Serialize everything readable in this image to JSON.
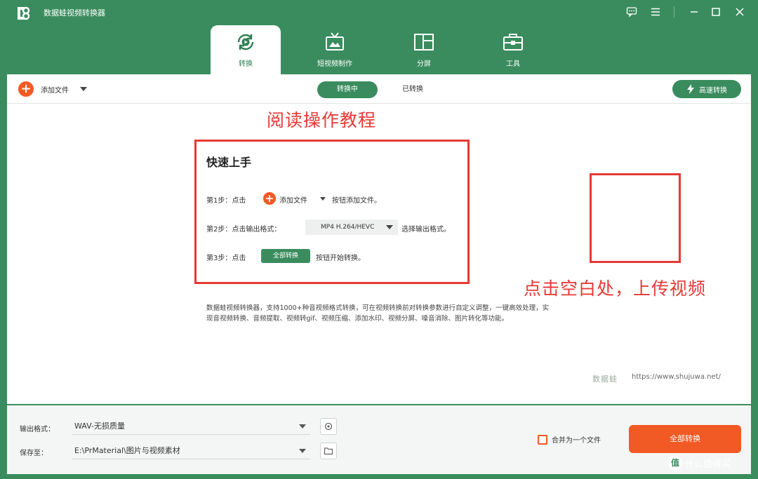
{
  "app": {
    "title": "数据蛙视频转换器"
  },
  "tabs": [
    {
      "label": "转换",
      "icon": "convert-icon",
      "active": true
    },
    {
      "label": "短视频制作",
      "icon": "tv-icon",
      "active": false
    },
    {
      "label": "分屏",
      "icon": "split-screen-icon",
      "active": false
    },
    {
      "label": "工具",
      "icon": "toolbox-icon",
      "active": false
    }
  ],
  "toolbar": {
    "add_file_label": "添加文件",
    "segment_converting": "转换中",
    "segment_converted": "已转换",
    "fast_convert_label": "高速转换"
  },
  "annotations": {
    "read_tutorial": "阅读操作教程",
    "click_upload": "点击空白处，上传视频"
  },
  "guide": {
    "heading": "快速上手",
    "step1_prefix": "第1步：点击",
    "step1_button": "添加文件",
    "step1_suffix": "按钮添加文件。",
    "step2_prefix": "第2步：点击输出格式：",
    "step2_format": "MP4 H.264/HEVC",
    "step2_suffix": "选择输出格式。",
    "step3_prefix": "第3步：点击",
    "step3_button": "全部转换",
    "step3_suffix": "按钮开始转换。"
  },
  "description": "数据蛙视频转换器，支持1000+种音视频格式转换，可在视频转换前对转换参数进行自定义调整，一键高效处理，实现音视频转换、音频提取、视频转gif、视频压缩、添加水印、视频分屏、噪音消除、图片转化等功能。",
  "brand": {
    "name": "数据蛙",
    "url": "https://www.shujuwa.net/"
  },
  "bottom": {
    "output_format_label": "输出格式：",
    "output_format_value": "WAV-无损质量",
    "save_to_label": "保存至：",
    "save_to_value": "E:\\PrMaterial\\图片与视频素材",
    "merge_label": "合并为一个文件",
    "convert_all_label": "全部转换"
  },
  "watermark": {
    "text": "什么值得买",
    "badge": "值"
  },
  "colors": {
    "brand_green": "#3a8c5e",
    "accent_orange": "#f15a24",
    "annotation_red": "#e53935"
  }
}
